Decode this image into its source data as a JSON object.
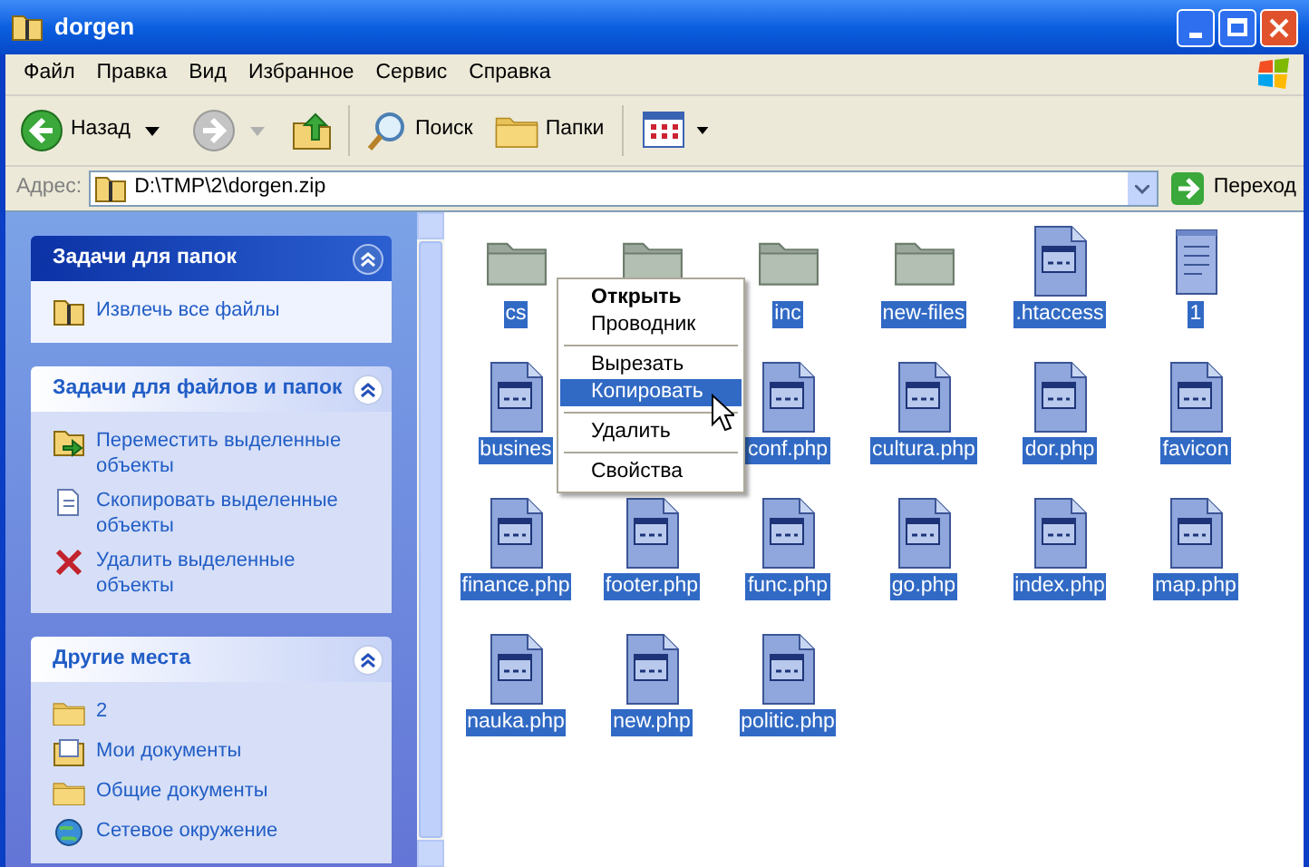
{
  "window": {
    "title": "dorgen"
  },
  "menu": [
    "Файл",
    "Правка",
    "Вид",
    "Избранное",
    "Сервис",
    "Справка"
  ],
  "toolbar": {
    "back": "Назад",
    "search": "Поиск",
    "folders": "Папки"
  },
  "address": {
    "label": "Адрес:",
    "value": "D:\\TMP\\2\\dorgen.zip",
    "go": "Переход"
  },
  "task_sections": [
    {
      "title": "Задачи для папок",
      "kind": "special",
      "items": [
        {
          "kind": "zip",
          "label": "Извлечь все файлы"
        }
      ]
    },
    {
      "title": "Задачи для файлов и папок",
      "kind": "normal",
      "items": [
        {
          "kind": "move",
          "label": "Переместить выделенные объекты"
        },
        {
          "kind": "copy",
          "label": "Скопировать выделенные объекты"
        },
        {
          "kind": "delete",
          "label": "Удалить выделенные объекты"
        }
      ]
    },
    {
      "title": "Другие места",
      "kind": "normal",
      "items": [
        {
          "kind": "folder",
          "label": "2"
        },
        {
          "kind": "docs",
          "label": "Мои документы"
        },
        {
          "kind": "folder",
          "label": "Общие документы"
        },
        {
          "kind": "network",
          "label": "Сетевое окружение"
        }
      ]
    }
  ],
  "files": [
    {
      "kind": "folder",
      "label": "cs",
      "selected": true
    },
    {
      "kind": "folder"
    },
    {
      "kind": "folder",
      "label": "inc",
      "selected": true
    },
    {
      "kind": "folder",
      "label": "new-files",
      "selected": true
    },
    {
      "kind": "php",
      "label": ".htaccess",
      "selected": true
    },
    {
      "kind": "text",
      "label": "1",
      "selected": true
    },
    {
      "kind": "php",
      "label": "busines",
      "selected": true
    },
    {
      "kind": "empty"
    },
    {
      "kind": "php",
      "label": "conf.php",
      "selected": true
    },
    {
      "kind": "php",
      "label": "cultura.php",
      "selected": true
    },
    {
      "kind": "php",
      "label": "dor.php",
      "selected": true
    },
    {
      "kind": "php",
      "label": "favicon",
      "selected": true
    },
    {
      "kind": "php",
      "label": "finance.php",
      "selected": true
    },
    {
      "kind": "php",
      "label": "footer.php",
      "selected": true
    },
    {
      "kind": "php",
      "label": "func.php",
      "selected": true
    },
    {
      "kind": "php",
      "label": "go.php",
      "selected": true
    },
    {
      "kind": "php",
      "label": "index.php",
      "selected": true
    },
    {
      "kind": "php",
      "label": "map.php",
      "selected": true
    },
    {
      "kind": "php",
      "label": "nauka.php",
      "selected": true
    },
    {
      "kind": "php",
      "label": "new.php",
      "selected": true
    },
    {
      "kind": "php",
      "label": "politic.php",
      "selected": true
    }
  ],
  "context_menu": [
    {
      "kind": "item",
      "label": "Открыть",
      "bold": true,
      "selected": false
    },
    {
      "kind": "item",
      "label": "Проводник",
      "bold": false,
      "selected": false
    },
    {
      "kind": "separator"
    },
    {
      "kind": "item",
      "label": "Вырезать",
      "bold": false,
      "selected": false
    },
    {
      "kind": "item",
      "label": "Копировать",
      "bold": false,
      "selected": true
    },
    {
      "kind": "separator"
    },
    {
      "kind": "item",
      "label": "Удалить",
      "bold": false,
      "selected": false
    },
    {
      "kind": "separator"
    },
    {
      "kind": "item",
      "label": "Свойства",
      "bold": false,
      "selected": false
    }
  ]
}
